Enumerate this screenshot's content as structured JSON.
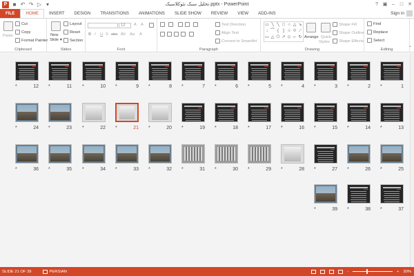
{
  "titlebar": {
    "app_icon": "P",
    "title": "تحلیل سبک نئوکلاسیک.pptx - PowerPoint",
    "qat": [
      "save-icon",
      "undo-icon",
      "redo-icon",
      "start-from-beginning-icon",
      "customize-qat-icon"
    ],
    "controls": [
      "?",
      "▣",
      "–",
      "□",
      "✕"
    ]
  },
  "tabs": {
    "items": [
      "FILE",
      "HOME",
      "INSERT",
      "DESIGN",
      "TRANSITIONS",
      "ANIMATIONS",
      "SLIDE SHOW",
      "REVIEW",
      "VIEW",
      "ADD-INS"
    ],
    "active": "HOME",
    "signin": "Sign in"
  },
  "ribbon": {
    "clipboard": {
      "paste": "Paste",
      "cut": "Cut",
      "copy": "Copy",
      "format_painter": "Format Painter",
      "label": "Clipboard"
    },
    "slides": {
      "new_slide": "New",
      "new_slide2": "Slide",
      "layout": "Layout",
      "reset": "Reset",
      "section": "Section",
      "label": "Slides"
    },
    "font": {
      "size": "12",
      "label": "Font",
      "b": "B",
      "i": "I",
      "u": "U",
      "s": "S",
      "abc": "abc",
      "av": "AV",
      "aa": "Aa",
      "a": "A"
    },
    "paragraph": {
      "text_direction": "Text Direction",
      "align_text": "Align Text",
      "smartart": "Convert to SmartArt",
      "label": "Paragraph"
    },
    "drawing": {
      "arrange": "Arrange",
      "quick_styles": "Quick",
      "quick_styles2": "Styles",
      "shape_fill": "Shape Fill",
      "shape_outline": "Shape Outline",
      "shape_effects": "Shape Effects",
      "label": "Drawing"
    },
    "editing": {
      "find": "Find",
      "replace": "Replace",
      "select": "Select",
      "label": "Editing"
    },
    "shape_glyphs": [
      "▭",
      "╲",
      "╲",
      "□",
      "○",
      "△",
      "↘",
      "↓",
      "⌒",
      "{",
      "}",
      "☆",
      "⟐",
      "⟋",
      "▭",
      "△",
      "⬠",
      "↗",
      "◇",
      "⌐",
      "↻"
    ]
  },
  "slides": {
    "rows": [
      [
        "12",
        "11",
        "10",
        "9",
        "8",
        "7",
        "6",
        "5",
        "4",
        "3",
        "2",
        "1"
      ],
      [
        "24",
        "23",
        "22",
        "21",
        "20",
        "19",
        "18",
        "17",
        "16",
        "15",
        "14",
        "13"
      ],
      [
        "36",
        "35",
        "34",
        "33",
        "32",
        "31",
        "30",
        "29",
        "28",
        "27",
        "26",
        "25"
      ],
      [
        "39",
        "38",
        "37"
      ]
    ],
    "selected": "21",
    "star": "*"
  },
  "statusbar": {
    "slide_info": "SLIDE 21 OF 39",
    "language": "PERSIAN",
    "zoom": "30%",
    "zoom_minus": "-",
    "zoom_plus": "+"
  },
  "colors": {
    "accent": "#d24726",
    "thumb_dark": "#262626",
    "sorter_bg": "#f3f3f3"
  }
}
